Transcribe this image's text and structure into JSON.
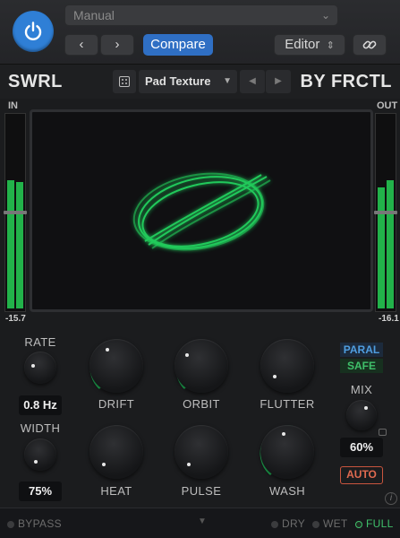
{
  "host": {
    "preset_value": "Manual",
    "back_label": "‹",
    "forward_label": "›",
    "compare_label": "Compare",
    "editor_label": "Editor",
    "editor_chevron": "⌃⌄",
    "link_icon": "link-icon",
    "power_icon": "power-icon",
    "power_color": "#2f7fd6"
  },
  "plugin": {
    "name": "SWRL",
    "vendor": "BY FRCTL",
    "preset_name": "Pad Texture",
    "dice_icon": "dice-icon",
    "prev_icon": "◀",
    "next_icon": "▶"
  },
  "meters": {
    "in_label": "IN",
    "out_label": "OUT",
    "in_value": "-15.7",
    "out_value": "-16.1",
    "in_levels": [
      0.67,
      0.66
    ],
    "out_levels": [
      0.63,
      0.67
    ]
  },
  "controls": {
    "rate": {
      "label": "RATE",
      "value": "0.8 Hz"
    },
    "width": {
      "label": "WIDTH",
      "value": "75%"
    },
    "drift": {
      "label": "DRIFT",
      "level": 0.45
    },
    "orbit": {
      "label": "ORBIT",
      "level": 0.35
    },
    "flutter": {
      "label": "FLUTTER",
      "level": 0.1
    },
    "heat": {
      "label": "HEAT",
      "level": 0.0
    },
    "pulse": {
      "label": "PULSE",
      "level": 0.0
    },
    "wash": {
      "label": "WASH",
      "level": 0.55
    },
    "mix": {
      "label": "MIX",
      "value": "60%"
    },
    "paral_label": "PARAL",
    "safe_label": "SAFE",
    "auto_label": "AUTO",
    "info_label": "i"
  },
  "footer": {
    "bypass": "BYPASS",
    "dry": "DRY",
    "wet": "WET",
    "full": "FULL"
  },
  "colors": {
    "accent_green": "#22c55e",
    "accent_blue": "#2f6fc4",
    "auto_red": "#e06a50"
  }
}
